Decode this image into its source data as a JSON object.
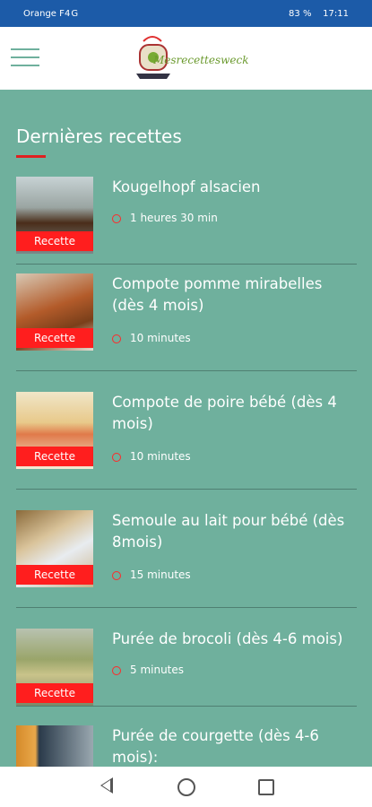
{
  "status": {
    "carrier": "Orange F",
    "signal": "4G",
    "battery": "83 %",
    "time": "17:11"
  },
  "logo": {
    "text": "Mesrecettesweck"
  },
  "page_title": "Dernières recettes",
  "tag_label": "Recette",
  "recipes": [
    {
      "title": "Kougelhopf alsacien",
      "time": "1 heures 30 min"
    },
    {
      "title": "Compote pomme mirabelles (dès 4 mois)",
      "time": "10 minutes"
    },
    {
      "title": "Compote de poire bébé (dès 4 mois)",
      "time": "10 minutes"
    },
    {
      "title": "Semoule au lait pour bébé (dès 8mois)",
      "time": "15 minutes"
    },
    {
      "title": "Purée de brocoli (dès 4-6 mois)",
      "time": "5 minutes"
    },
    {
      "title": "Purée de courgette (dès 4-6 mois):",
      "time": ""
    }
  ]
}
